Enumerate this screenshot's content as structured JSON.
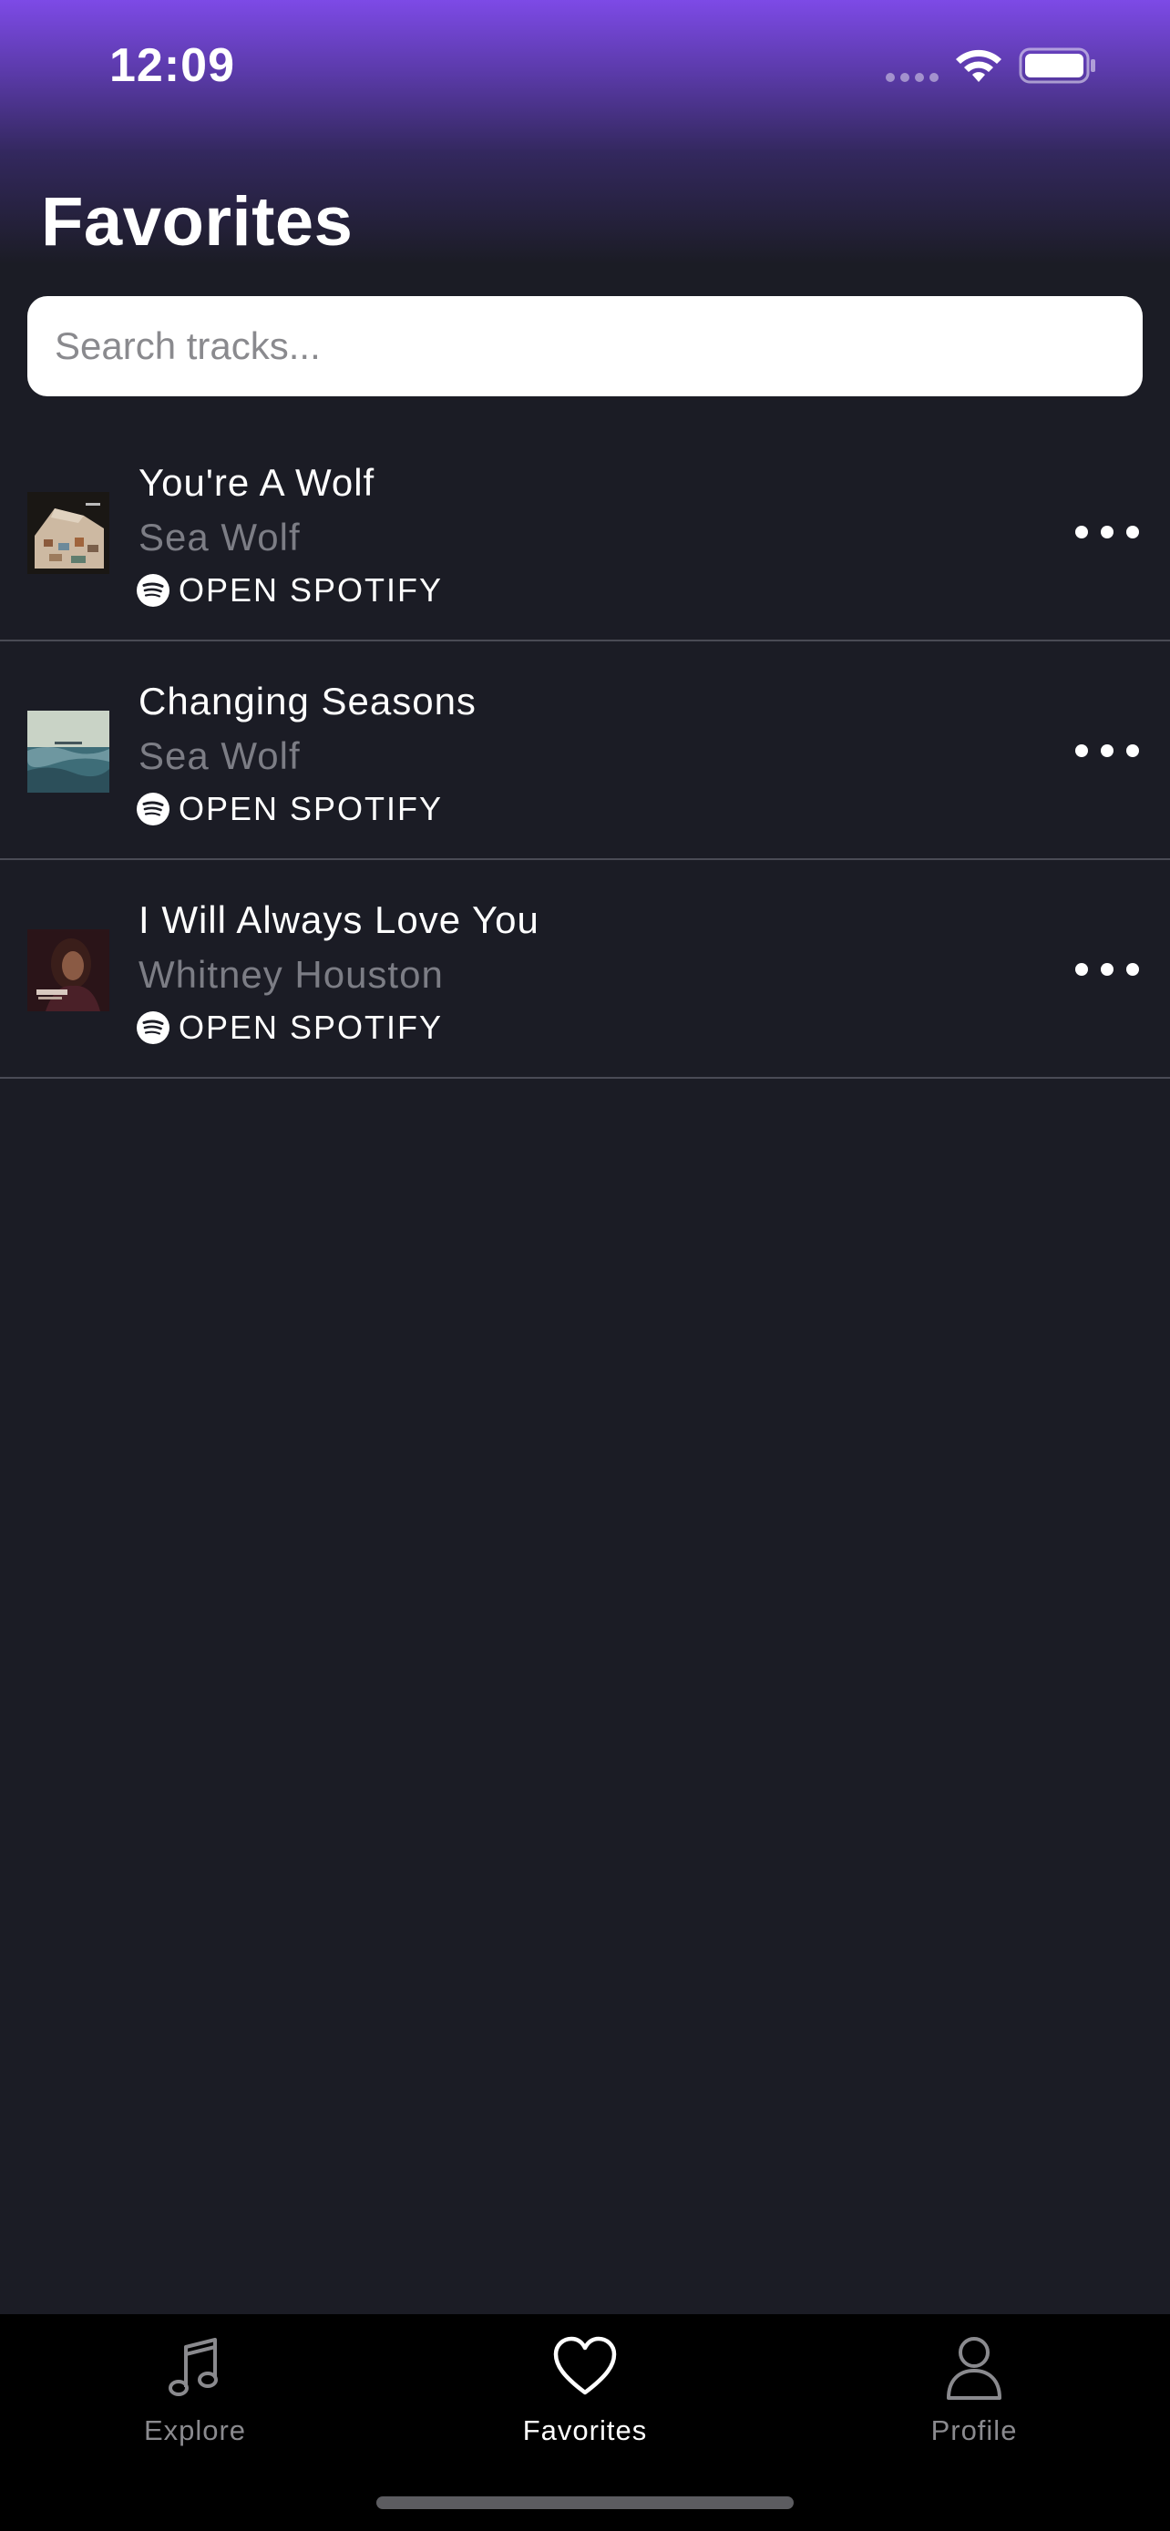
{
  "status_bar": {
    "time": "12:09"
  },
  "header": {
    "title": "Favorites"
  },
  "search": {
    "placeholder": "Search tracks..."
  },
  "tracks": [
    {
      "title": "You're A Wolf",
      "artist": "Sea Wolf",
      "action_label": "OPEN SPOTIFY"
    },
    {
      "title": "Changing Seasons",
      "artist": "Sea Wolf",
      "action_label": "OPEN SPOTIFY"
    },
    {
      "title": "I Will Always Love You",
      "artist": "Whitney Houston",
      "action_label": "OPEN SPOTIFY"
    }
  ],
  "tab_bar": {
    "tabs": [
      {
        "label": "Explore",
        "icon": "music-note-icon",
        "active": false
      },
      {
        "label": "Favorites",
        "icon": "heart-icon",
        "active": true
      },
      {
        "label": "Profile",
        "icon": "person-icon",
        "active": false
      }
    ]
  },
  "colors": {
    "background": "#1b1c25",
    "accent_gradient_top": "#7d4ae6",
    "tab_bar": "#000000",
    "secondary_text": "#7c7d85"
  }
}
